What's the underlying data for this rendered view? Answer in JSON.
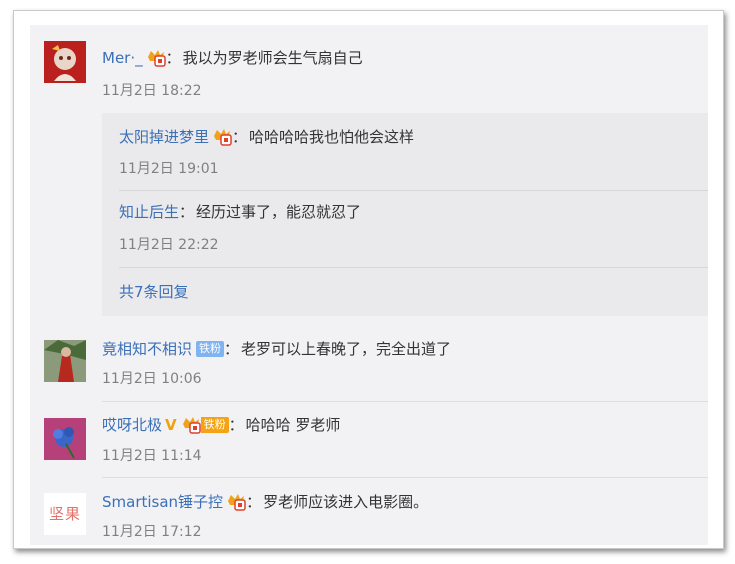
{
  "comments": [
    {
      "user": "Mer·_",
      "text": "我以为罗老师会生气扇自己",
      "time": "11月2日 18:22",
      "replies": [
        {
          "user": "太阳掉进梦里",
          "text": "哈哈哈哈我也怕他会这样",
          "time": "11月2日 19:01"
        },
        {
          "user": "知止后生",
          "text": "经历过事了，能忍就忍了",
          "time": "11月2日 22:22"
        }
      ],
      "more_label": "共7条回复"
    },
    {
      "user": "竟相知不相识",
      "fan_badge": "铁粉",
      "text": "老罗可以上春晚了，完全出道了",
      "time": "11月2日 10:06"
    },
    {
      "user": "哎呀北极",
      "verified": "V",
      "fan_badge": "铁粉",
      "text": "哈哈哈 罗老师",
      "time": "11月2日 11:14"
    },
    {
      "user": "Smartisan锤子控",
      "text": "罗老师应该进入电影圈。",
      "time": "11月2日 17:12",
      "avatar_text": "坚果"
    }
  ],
  "colon": "：",
  "colors": {
    "link": "#3b6fb6",
    "text": "#333333",
    "muted": "#808080",
    "panel": "#f2f2f5",
    "fan": "#7fb4f0",
    "fan_gold": "#f4a315"
  }
}
